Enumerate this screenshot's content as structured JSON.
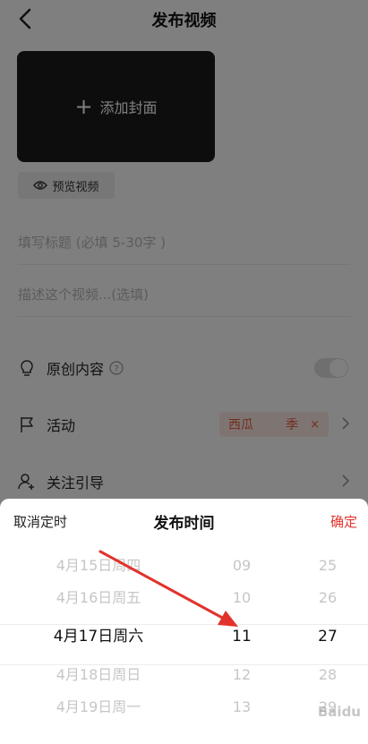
{
  "header": {
    "title": "发布视频"
  },
  "cover": {
    "label": "添加封面"
  },
  "preview": {
    "label": "预览视频"
  },
  "fields": {
    "title_placeholder": "填写标题 (必填 5-30字 )",
    "desc_placeholder": "描述这个视频...(选填)"
  },
  "rows": {
    "original": {
      "label": "原创内容"
    },
    "activity": {
      "label": "活动",
      "tag_text": "西瓜",
      "tag_suffix": "季",
      "tag_close": "×"
    },
    "follow": {
      "label": "关注引导"
    }
  },
  "sheet": {
    "cancel": "取消定时",
    "title": "发布时间",
    "confirm": "确定",
    "dates": [
      "4月15日周四",
      "4月16日周五",
      "4月17日周六",
      "4月18日周日",
      "4月19日周一"
    ],
    "hours": [
      "09",
      "10",
      "11",
      "12",
      "13"
    ],
    "minutes": [
      "25",
      "26",
      "27",
      "28",
      "29"
    ],
    "selected_index": 2
  },
  "colors": {
    "accent": "#e0332c",
    "tag_bg": "#fdeae6",
    "tag_text": "#e85a3c"
  },
  "watermark": "Baidu"
}
